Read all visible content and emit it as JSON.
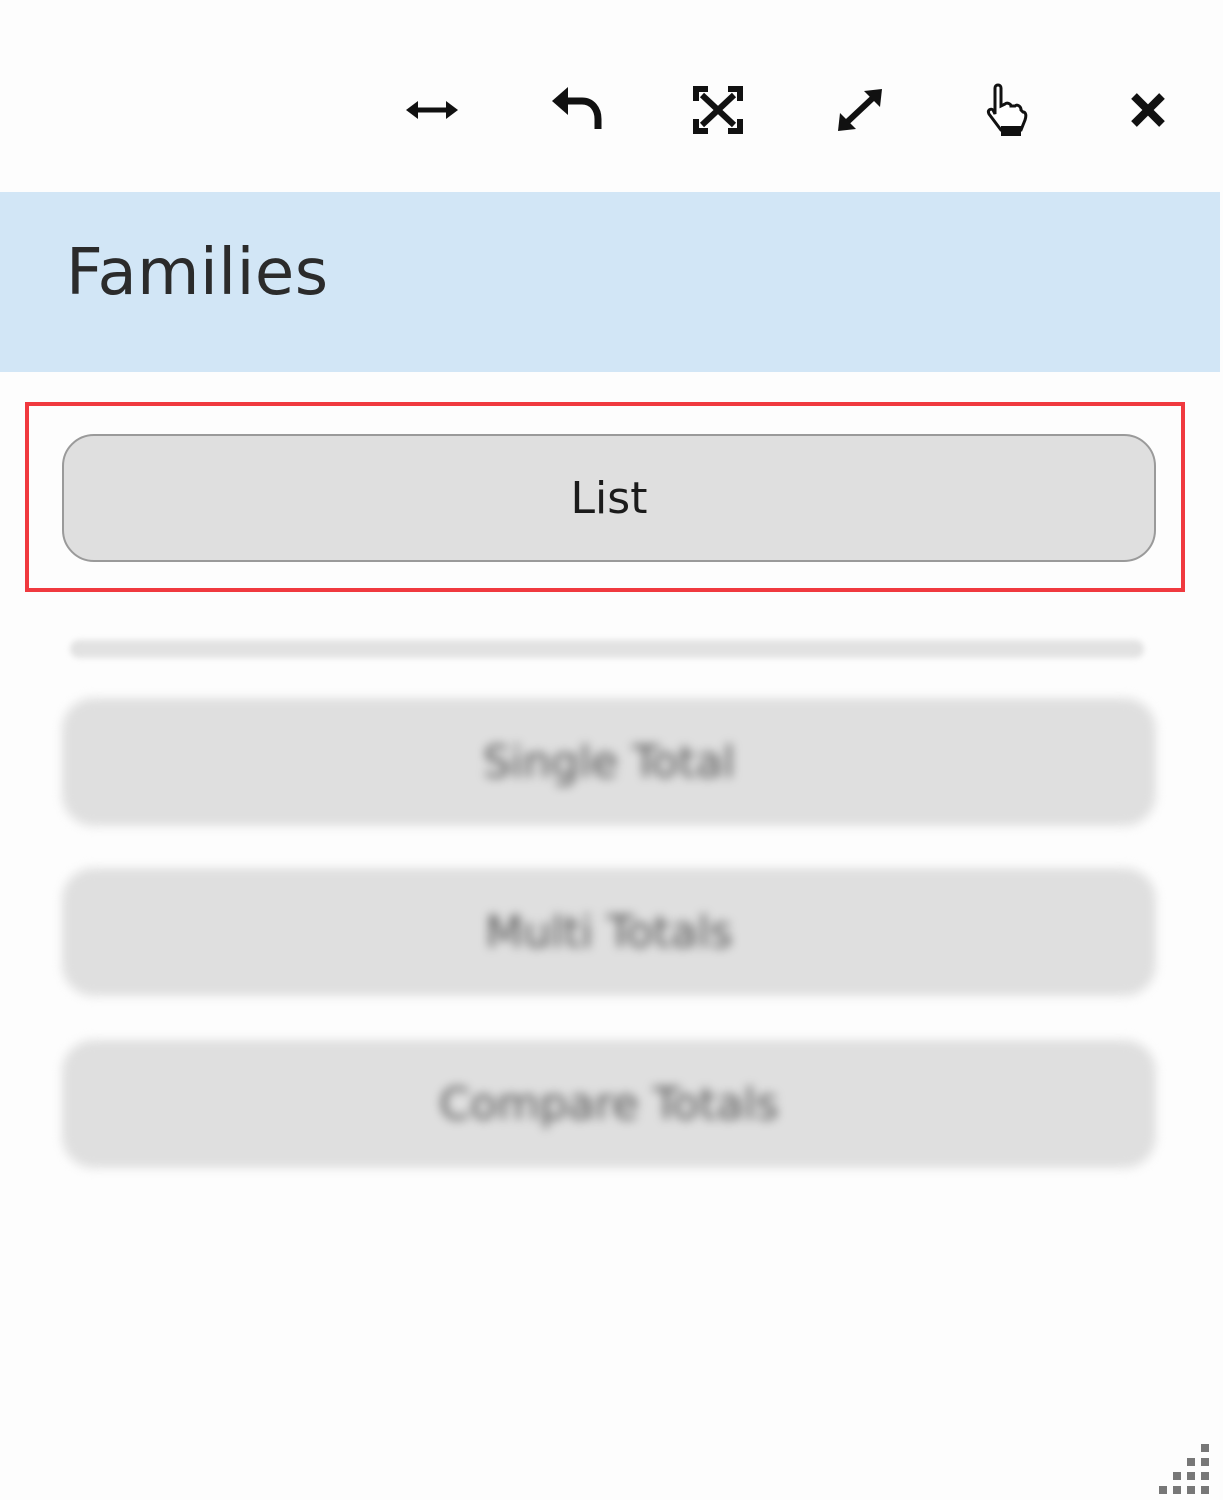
{
  "toolbar": {
    "icons": [
      {
        "name": "resize-horizontal-icon",
        "label": "Resize horizontal"
      },
      {
        "name": "undo-icon",
        "label": "Undo"
      },
      {
        "name": "fit-screen-icon",
        "label": "Fit"
      },
      {
        "name": "expand-icon",
        "label": "Expand"
      },
      {
        "name": "hand-pointer-icon",
        "label": "Interact"
      },
      {
        "name": "close-icon",
        "label": "Close"
      }
    ]
  },
  "header": {
    "title": "Families",
    "background": "#d2e6f6"
  },
  "buttons": {
    "list": "List",
    "single_total": "Single Total",
    "multi_totals": "Multi Totals",
    "compare_totals": "Compare Totals"
  },
  "colors": {
    "highlight": "#f0393f",
    "button_bg": "#dfdfdf"
  }
}
